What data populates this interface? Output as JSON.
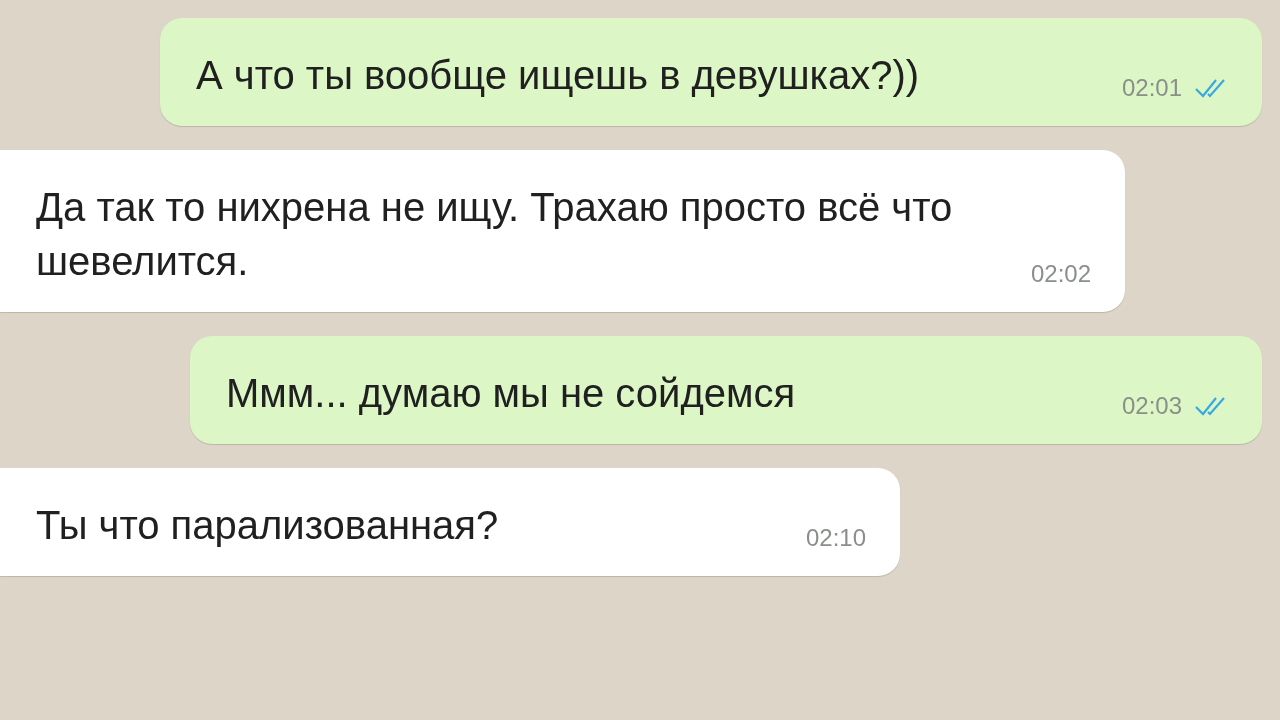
{
  "messages": [
    {
      "kind": "out",
      "text": "А что ты вообще ищешь в девушках?))",
      "time": "02:01",
      "read": true
    },
    {
      "kind": "in",
      "text": "Да так то нихрена не ищу. Трахаю просто всё что шевелится.",
      "time": "02:02"
    },
    {
      "kind": "out",
      "text": "Ммм... думаю мы не сойдемся",
      "time": "02:03",
      "read": true
    },
    {
      "kind": "in",
      "text": "Ты что парализованная?",
      "time": "02:10"
    }
  ]
}
